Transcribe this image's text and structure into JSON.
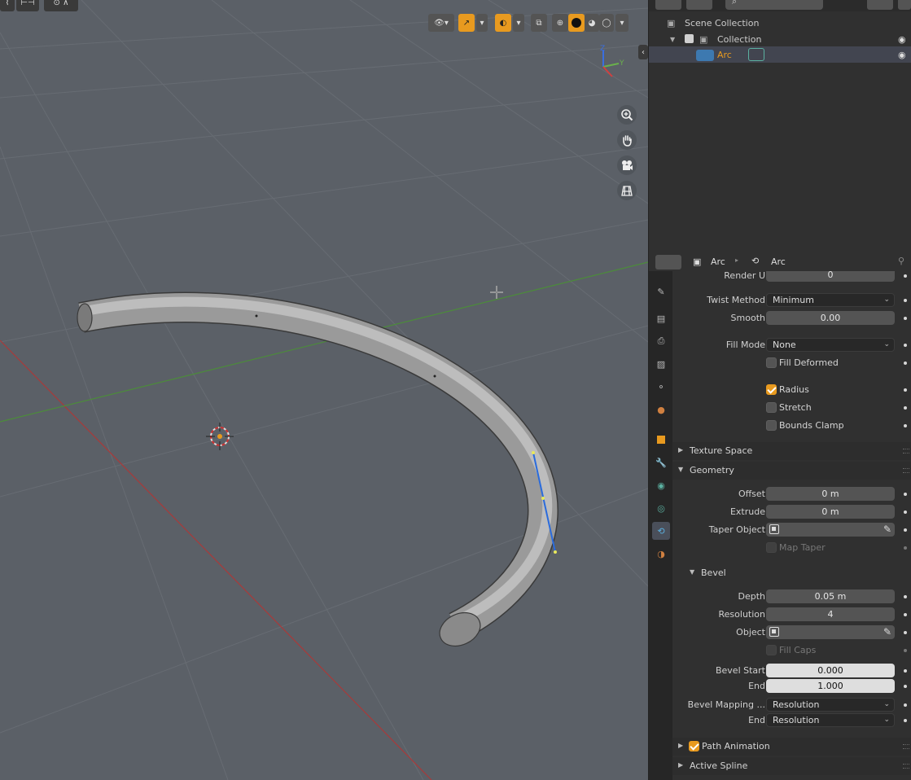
{
  "colors": {
    "accent": "#e89a1f",
    "viewport_bg": "#5b6067",
    "x_axis": "#a83a3a",
    "y_axis": "#4c8c3a",
    "selection_blue": "#2a6bdc"
  },
  "viewport": {
    "gizmo_axes": {
      "z": "Z",
      "y": "Y"
    },
    "icons": [
      "visibility-icon",
      "gizmo-icon",
      "overlay-icon",
      "xray-icon",
      "wireframe-shading-icon",
      "solid-shading-icon",
      "material-shading-icon",
      "rendered-shading-icon"
    ],
    "nav_buttons": [
      "zoom-icon",
      "pan-hand-icon",
      "camera-icon",
      "grid-ortho-icon"
    ]
  },
  "outliner": {
    "scene_collection": "Scene Collection",
    "collection": "Collection",
    "object": "Arc"
  },
  "properties": {
    "breadcrumb": {
      "object": "Arc",
      "data": "Arc"
    },
    "render_u": {
      "label": "Render U",
      "value": "0"
    },
    "twist_method": {
      "label": "Twist Method",
      "value": "Minimum"
    },
    "smooth": {
      "label": "Smooth",
      "value": "0.00"
    },
    "fill_mode": {
      "label": "Fill Mode",
      "value": "None"
    },
    "fill_deformed": {
      "label": "Fill Deformed",
      "checked": false
    },
    "radius": {
      "label": "Radius",
      "checked": true
    },
    "stretch": {
      "label": "Stretch",
      "checked": false
    },
    "bounds_clamp": {
      "label": "Bounds Clamp",
      "checked": false
    },
    "texture_space": "Texture Space",
    "geometry": "Geometry",
    "offset": {
      "label": "Offset",
      "value": "0 m"
    },
    "extrude": {
      "label": "Extrude",
      "value": "0 m"
    },
    "taper_object": {
      "label": "Taper Object"
    },
    "map_taper": {
      "label": "Map Taper",
      "checked": false
    },
    "bevel": "Bevel",
    "depth": {
      "label": "Depth",
      "value": "0.05 m"
    },
    "resolution": {
      "label": "Resolution",
      "value": "4"
    },
    "object": {
      "label": "Object"
    },
    "fill_caps": {
      "label": "Fill Caps",
      "checked": false
    },
    "bevel_start": {
      "label": "Bevel Start",
      "value": "0.000"
    },
    "bevel_end": {
      "label": "End",
      "value": "1.000"
    },
    "bevel_mapping_start": {
      "label": "Bevel Mapping ...",
      "value": "Resolution"
    },
    "bevel_mapping_end": {
      "label": "End",
      "value": "Resolution"
    },
    "path_animation": {
      "label": "Path Animation",
      "checked": true
    },
    "active_spline": "Active Spline"
  }
}
